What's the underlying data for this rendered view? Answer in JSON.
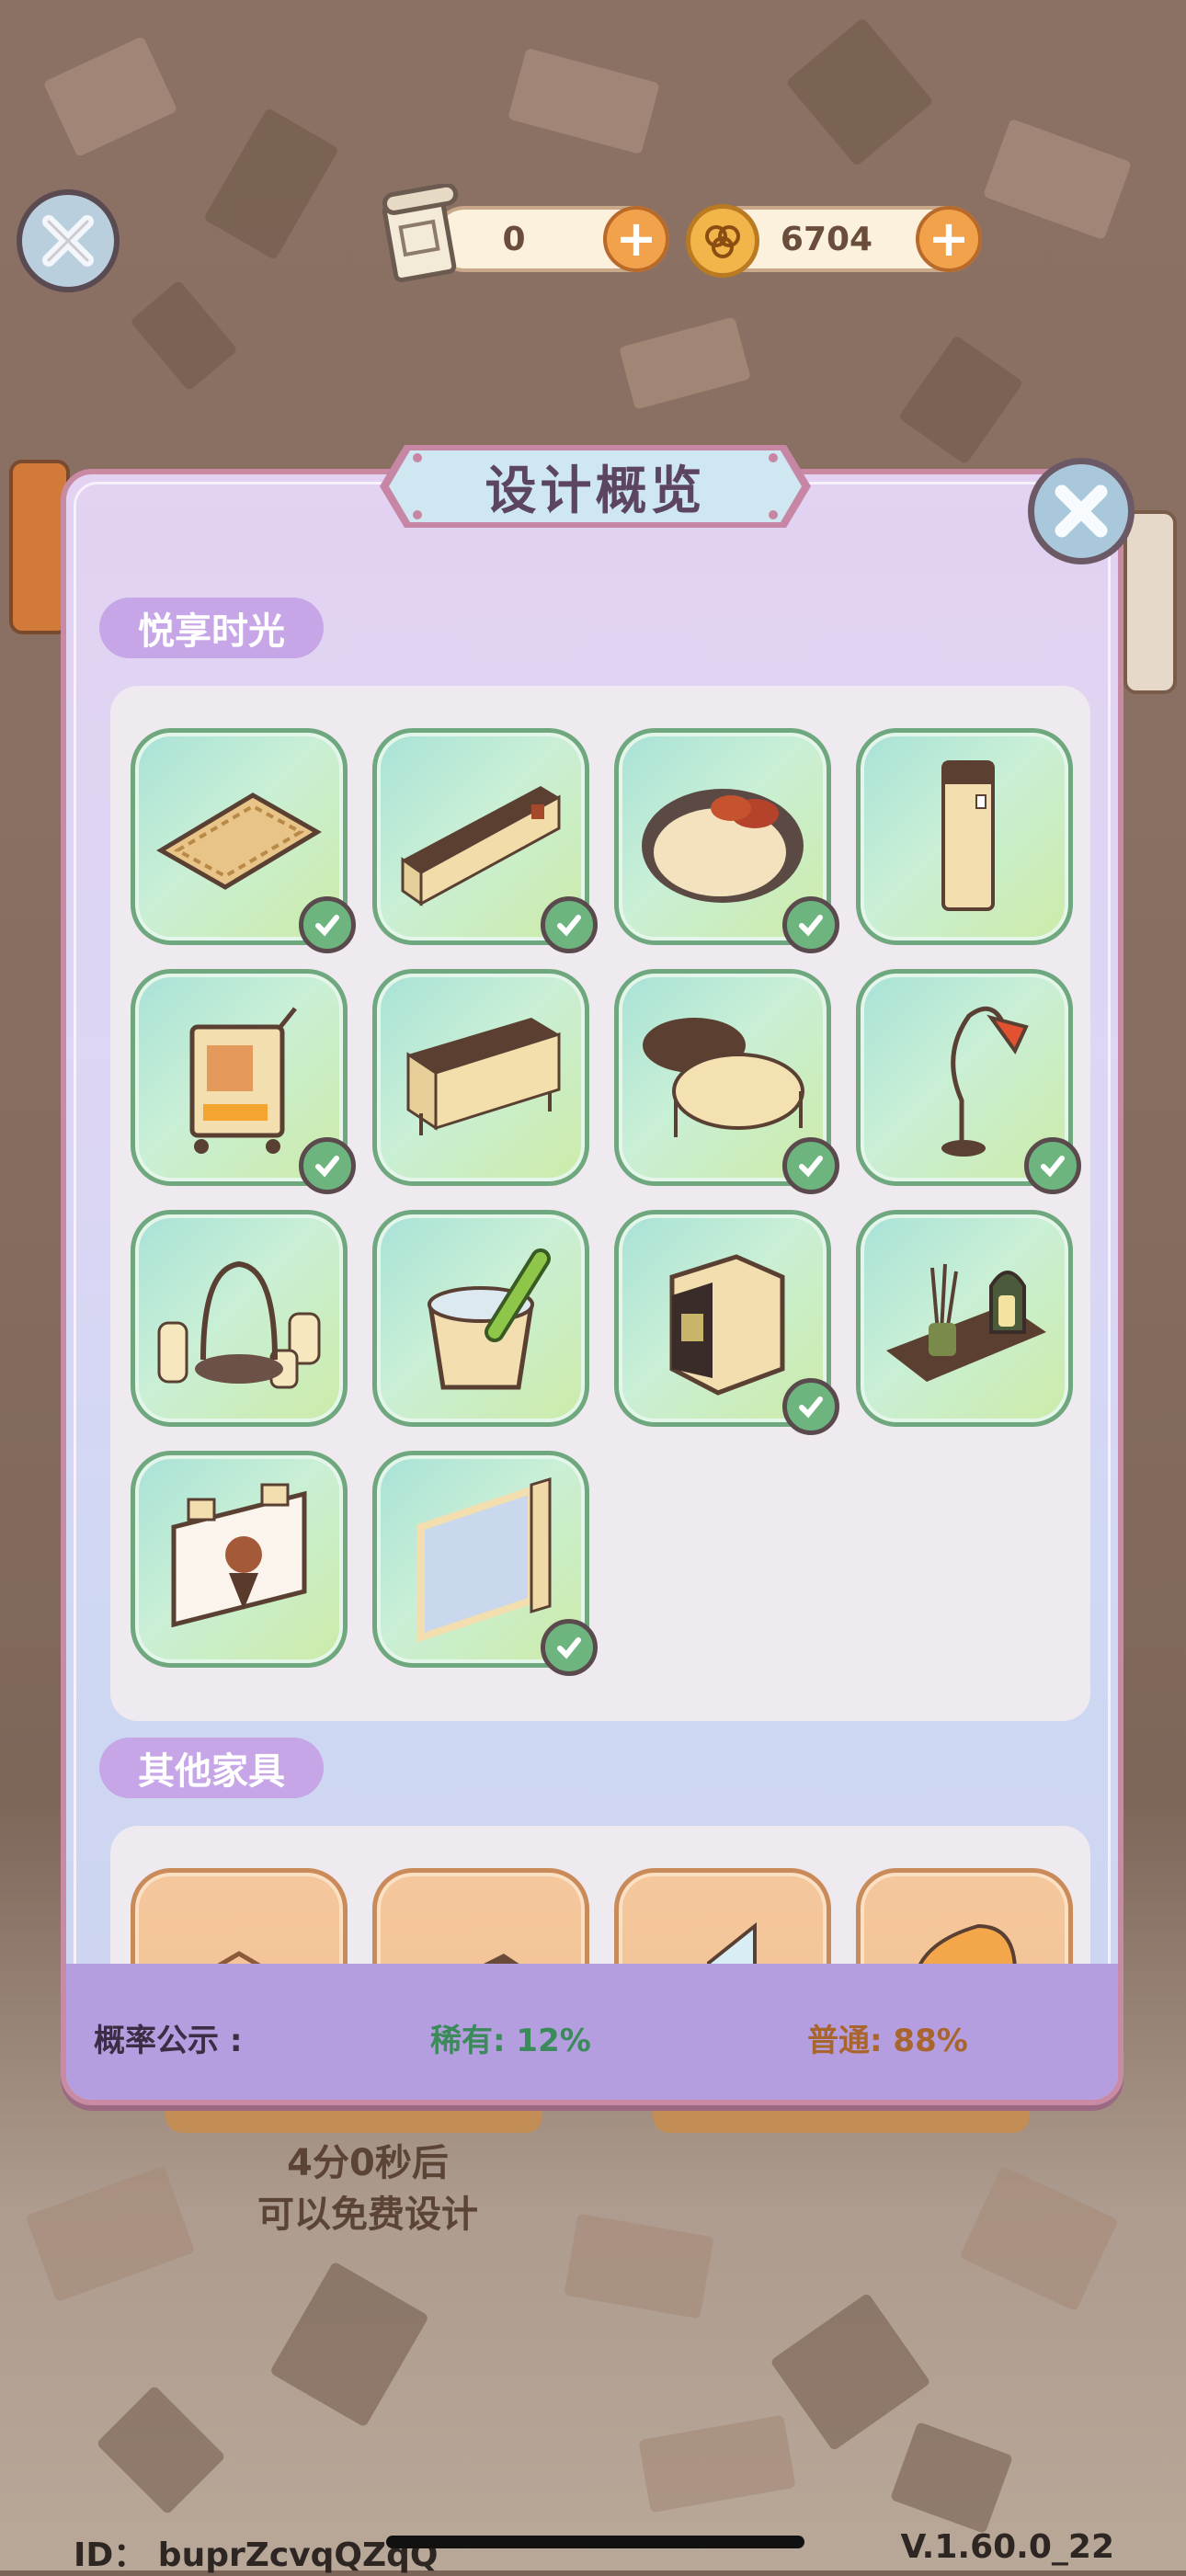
{
  "hud": {
    "design_scroll_count": "0",
    "coin_count": "6704"
  },
  "modal": {
    "title": "设计概览",
    "sections": [
      {
        "label": "悦享时光",
        "items": [
          {
            "icon": "rug-icon",
            "owned": true
          },
          {
            "icon": "tv-cabinet-icon",
            "owned": true
          },
          {
            "icon": "round-bed-icon",
            "owned": true
          },
          {
            "icon": "tower-speaker-icon",
            "owned": false
          },
          {
            "icon": "fireplace-cart-icon",
            "owned": true
          },
          {
            "icon": "sideboard-icon",
            "owned": false
          },
          {
            "icon": "round-tables-icon",
            "owned": true
          },
          {
            "icon": "arc-floor-lamp-icon",
            "owned": true
          },
          {
            "icon": "candle-lantern-icon",
            "owned": false
          },
          {
            "icon": "wine-bucket-icon",
            "owned": false
          },
          {
            "icon": "mini-fridge-icon",
            "owned": true
          },
          {
            "icon": "aroma-tray-icon",
            "owned": false
          },
          {
            "icon": "poster-board-icon",
            "owned": false
          },
          {
            "icon": "window-curtain-icon",
            "owned": true
          }
        ]
      },
      {
        "label": "其他家具",
        "items": [
          {
            "icon": "rug-icon"
          },
          {
            "icon": "table-top-icon"
          },
          {
            "icon": "mirror-icon"
          },
          {
            "icon": "chair-icon"
          }
        ]
      }
    ],
    "probability": {
      "label": "概率公示 :",
      "rare": "稀有: 12%",
      "common": "普通: 88%"
    }
  },
  "behind": {
    "free_design_text_1": "4分0秒后",
    "free_design_text_2": "可以免费设计"
  },
  "footer": {
    "id_text": "ID： buprZcvqQZqQ",
    "version": "V.1.60.0_22"
  }
}
